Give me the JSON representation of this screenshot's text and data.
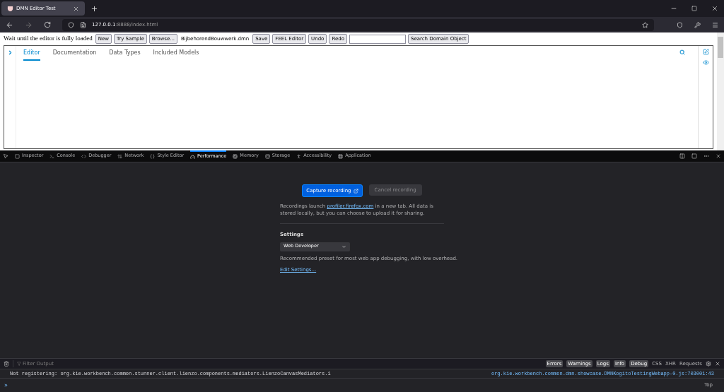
{
  "browser_tab": {
    "title": "DMN Editor Test",
    "selected": true
  },
  "address": {
    "host": "127.0.0.1",
    "rest": ":8888/index.html"
  },
  "page_toolbar": {
    "notice": "Wait until the editor is fully loaded",
    "buttons_a": [
      "New",
      "Try Sample",
      "Browse..."
    ],
    "file_name": "BijbehorendBouwwerk.dmn",
    "buttons_b": [
      "Save",
      "FEEL Editor",
      "Undo",
      "Redo"
    ],
    "search_button": "Search Domain Object"
  },
  "editor_tabs": [
    {
      "label": "Editor",
      "selected": true
    },
    {
      "label": "Documentation",
      "selected": false
    },
    {
      "label": "Data Types",
      "selected": false
    },
    {
      "label": "Included Models",
      "selected": false
    }
  ],
  "devtools_tabs": [
    {
      "label": "Inspector",
      "selected": false
    },
    {
      "label": "Console",
      "selected": false
    },
    {
      "label": "Debugger",
      "selected": false
    },
    {
      "label": "Network",
      "selected": false
    },
    {
      "label": "Style Editor",
      "selected": false
    },
    {
      "label": "Performance",
      "selected": true
    },
    {
      "label": "Memory",
      "selected": false
    },
    {
      "label": "Storage",
      "selected": false
    },
    {
      "label": "Accessibility",
      "selected": false
    },
    {
      "label": "Application",
      "selected": false
    }
  ],
  "performance": {
    "capture": "Capture recording",
    "cancel": "Cancel recording",
    "info_before": "Recordings launch ",
    "info_link": "profiler.firefox.com",
    "info_after": " in a new tab. All data is stored locally, but you can choose to upload it for sharing.",
    "settings_title": "Settings",
    "preset": "Web Developer",
    "preset_hint": "Recommended preset for most web app debugging, with low overhead.",
    "edit_link": "Edit Settings..."
  },
  "console": {
    "filter_placeholder": "Filter Output",
    "levels": [
      {
        "label": "Errors",
        "on": true
      },
      {
        "label": "Warnings",
        "on": true
      },
      {
        "label": "Logs",
        "on": true
      },
      {
        "label": "Info",
        "on": true
      },
      {
        "label": "Debug",
        "on": true
      }
    ],
    "extra": [
      "CSS",
      "XHR",
      "Requests"
    ],
    "message": "Not registering: org.kie.workbench.common.stunner.client.lienzo.components.mediators.LienzoCanvasMediators.1",
    "source": "org.kie.workbench.common.dmn.showcase.DMNKogitoTestingWebapp-0.js:703001:43",
    "prompt": "»",
    "context": "Top"
  }
}
